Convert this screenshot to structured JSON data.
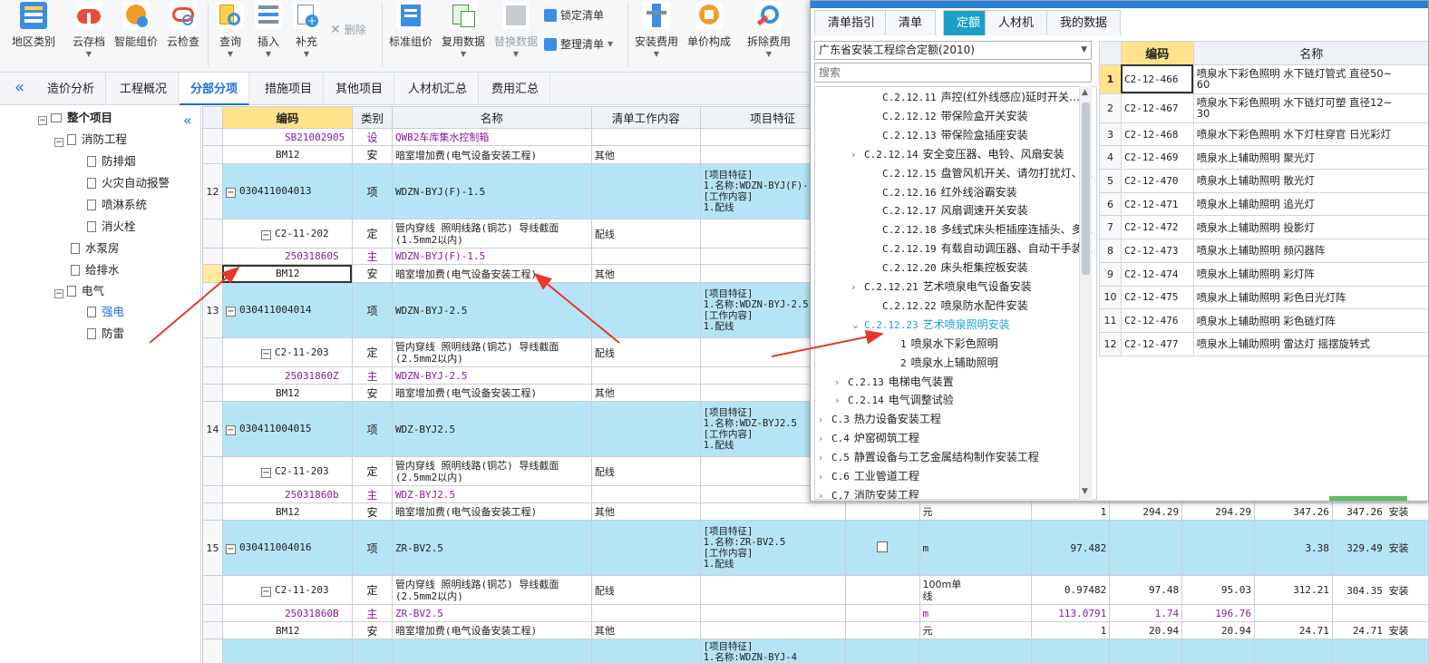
{
  "toolbar": {
    "buttons": [
      {
        "label": "地区类别",
        "icon": "region-category-icon"
      },
      {
        "label": "云存档",
        "icon": "cloud-save-icon"
      },
      {
        "label": "智能组价",
        "icon": "smart-pricing-icon"
      },
      {
        "label": "云检查",
        "icon": "cloud-check-icon"
      },
      {
        "label": "查询",
        "icon": "query-icon"
      },
      {
        "label": "插入",
        "icon": "insert-icon"
      },
      {
        "label": "补充",
        "icon": "supplement-icon"
      },
      {
        "label": "标准组价",
        "icon": "standard-pricing-icon"
      },
      {
        "label": "复用数据",
        "icon": "reuse-data-icon"
      },
      {
        "label": "替换数据",
        "icon": "replace-data-icon"
      },
      {
        "label": "安装费用",
        "icon": "install-fee-icon"
      },
      {
        "label": "单价构成",
        "icon": "unit-price-icon"
      },
      {
        "label": "拆除费用",
        "icon": "demolish-fee-icon"
      }
    ],
    "delete_label": "删除",
    "lock_list_label": "锁定清单",
    "organize_list_label": "整理清单"
  },
  "tabs": [
    "造价分析",
    "工程概况",
    "分部分项",
    "措施项目",
    "其他项目",
    "人材机汇总",
    "费用汇总"
  ],
  "active_tab": "分部分项",
  "tree": {
    "root": "整个项目",
    "nodes": [
      "消防工程",
      "防排烟",
      "火灾自动报警",
      "喷淋系统",
      "消火栓",
      "水泵房",
      "给排水",
      "电气",
      "强电",
      "防雷"
    ]
  },
  "grid": {
    "headers": [
      "编码",
      "类别",
      "名称",
      "清单工作内容",
      "项目特征"
    ],
    "rows": [
      {
        "code": "SB21002905",
        "type": "设",
        "name": "QWB2车库集水控制箱",
        "work": "",
        "feat": "",
        "purple": true
      },
      {
        "code": "BM12",
        "type": "安",
        "name": "暗室增加费(电气设备安装工程)",
        "work": "其他"
      },
      {
        "rn": "12",
        "code": "030411004013",
        "type": "项",
        "name": "WDZN-BYJ(F)-1.5",
        "feat": "[项目特征]\n1.名称:WDZN-BYJ(F)-1.5\n[工作内容]\n1.配线"
      },
      {
        "code": "C2-11-202",
        "type": "定",
        "name": "管内穿线 照明线路(铜芯) 导线截面\n(1.5mm2以内)",
        "work": "配线"
      },
      {
        "code": "25031860S",
        "type": "主",
        "name": "WDZN-BYJ(F)-1.5",
        "purple": true
      },
      {
        "code": "BM12",
        "type": "安",
        "name": "暗室增加费(电气设备安装工程)",
        "work": "其他"
      },
      {
        "rn": "13",
        "code": "030411004014",
        "type": "项",
        "name": "WDZN-BYJ-2.5",
        "feat": "[项目特征]\n1.名称:WDZN-BYJ-2.5\n[工作内容]\n1.配线"
      },
      {
        "code": "C2-11-203",
        "type": "定",
        "name": "管内穿线 照明线路(铜芯) 导线截面\n(2.5mm2以内)",
        "work": "配线"
      },
      {
        "code": "25031860Z",
        "type": "主",
        "name": "WDZN-BYJ-2.5",
        "purple": true
      },
      {
        "code": "BM12",
        "type": "安",
        "name": "暗室增加费(电气设备安装工程)",
        "work": "其他"
      },
      {
        "rn": "14",
        "code": "030411004015",
        "type": "项",
        "name": "WDZ-BYJ2.5",
        "feat": "[项目特征]\n1.名称:WDZ-BYJ2.5\n[工作内容]\n1.配线"
      },
      {
        "code": "C2-11-203",
        "type": "定",
        "name": "管内穿线 照明线路(铜芯) 导线截面\n(2.5mm2以内)",
        "work": "配线"
      },
      {
        "code": "25031860b",
        "type": "主",
        "name": "WDZ-BYJ2.5",
        "purple": true
      },
      {
        "code": "BM12",
        "type": "安",
        "name": "暗室增加费(电气设备安装工程)",
        "work": "其他",
        "unit": "元",
        "qty": "1",
        "v1": "294.29",
        "v2": "294.29",
        "v3": "347.26",
        "v4": "347.26",
        "last": "安装"
      },
      {
        "rn": "15",
        "code": "030411004016",
        "type": "项",
        "name": "ZR-BV2.5",
        "feat": "[项目特征]\n1.名称:ZR-BV2.5\n[工作内容]\n1.配线",
        "unit": "m",
        "qty": "97.482",
        "v3": "3.38",
        "v4": "329.49",
        "last": "安装"
      },
      {
        "code": "C2-11-203",
        "type": "定",
        "name": "管内穿线 照明线路(铜芯) 导线截面\n(2.5mm2以内)",
        "work": "配线",
        "unit": "100m单\n线",
        "qty": "0.97482",
        "v1": "97.48",
        "v2": "95.03",
        "v3": "312.21",
        "v4": "304.35",
        "last": "安装"
      },
      {
        "code": "25031860B",
        "type": "主",
        "name": "ZR-BV2.5",
        "unit": "m",
        "qty": "113.0791",
        "v1": "1.74",
        "v2": "196.76",
        "purple": true
      },
      {
        "code": "BM12",
        "type": "安",
        "name": "暗室增加费(电气设备安装工程)",
        "work": "其他",
        "unit": "元",
        "qty": "1",
        "v1": "20.94",
        "v2": "20.94",
        "v3": "24.71",
        "v4": "24.71",
        "last": "安装"
      },
      {
        "feat": "[项目特征]\n1.名称:WDZN-BYJ-4"
      }
    ]
  },
  "panel": {
    "tabs": [
      "清单指引",
      "清单",
      "定额",
      "人材机",
      "我的数据"
    ],
    "active_tab": "定额",
    "quota_select": "广东省安装工程综合定额(2010)",
    "search_placeholder": "搜索",
    "tree": [
      {
        "code": "C.2.12.11",
        "name": "声控(红外线感应)延时开关…"
      },
      {
        "code": "C.2.12.12",
        "name": "带保险盒开关安装"
      },
      {
        "code": "C.2.12.13",
        "name": "带保险盒插座安装"
      },
      {
        "code": "C.2.12.14",
        "name": "安全变压器、电铃、风扇安装",
        "chev": "›"
      },
      {
        "code": "C.2.12.15",
        "name": "盘管风机开关、请勿打扰灯、…"
      },
      {
        "code": "C.2.12.16",
        "name": "红外线浴霸安装"
      },
      {
        "code": "C.2.12.17",
        "name": "风扇调速开关安装"
      },
      {
        "code": "C.2.12.18",
        "name": "多线式床头柜插座连插头、多…"
      },
      {
        "code": "C.2.12.19",
        "name": "有载自动调压器、自动干手装…"
      },
      {
        "code": "C.2.12.20",
        "name": "床头柜集控板安装"
      },
      {
        "code": "C.2.12.21",
        "name": "艺术喷泉电气设备安装",
        "chev": "›"
      },
      {
        "code": "C.2.12.22",
        "name": "喷泉防水配件安装"
      },
      {
        "code": "C.2.12.23",
        "name": "艺术喷泉照明安装",
        "chev": "⌄",
        "sel": true
      },
      {
        "code": "1",
        "name": "喷泉水下彩色照明"
      },
      {
        "code": "2",
        "name": "喷泉水上辅助照明"
      },
      {
        "code": "C.2.13",
        "name": "电梯电气装置",
        "chev": "›"
      },
      {
        "code": "C.2.14",
        "name": "电气调整试验",
        "chev": "›"
      },
      {
        "code": "C.3",
        "name": "热力设备安装工程",
        "chev": "›"
      },
      {
        "code": "C.4",
        "name": "炉窑砌筑工程",
        "chev": "›"
      },
      {
        "code": "C.5",
        "name": "静置设备与工艺金属结构制作安装工程",
        "chev": "›"
      },
      {
        "code": "C.6",
        "name": "工业管道工程",
        "chev": "›"
      },
      {
        "code": "C.7",
        "name": "消防安装工程",
        "chev": "›"
      }
    ],
    "table_headers": [
      "编码",
      "名称"
    ],
    "table_rows": [
      {
        "i": "1",
        "code": "C2-12-466",
        "name": "喷泉水下彩色照明 水下链灯管式 直径50~\n60"
      },
      {
        "i": "2",
        "code": "C2-12-467",
        "name": "喷泉水下彩色照明 水下链灯可塑 直径12~\n30"
      },
      {
        "i": "3",
        "code": "C2-12-468",
        "name": "喷泉水下彩色照明 水下灯柱穿官 日光彩灯"
      },
      {
        "i": "4",
        "code": "C2-12-469",
        "name": "喷泉水上辅助照明 聚光灯"
      },
      {
        "i": "5",
        "code": "C2-12-470",
        "name": "喷泉水上辅助照明 散光灯"
      },
      {
        "i": "6",
        "code": "C2-12-471",
        "name": "喷泉水上辅助照明 追光灯"
      },
      {
        "i": "7",
        "code": "C2-12-472",
        "name": "喷泉水上辅助照明 投影灯"
      },
      {
        "i": "8",
        "code": "C2-12-473",
        "name": "喷泉水上辅助照明 频闪器阵"
      },
      {
        "i": "9",
        "code": "C2-12-474",
        "name": "喷泉水上辅助照明 彩灯阵"
      },
      {
        "i": "10",
        "code": "C2-12-475",
        "name": "喷泉水上辅助照明 彩色日光灯阵"
      },
      {
        "i": "11",
        "code": "C2-12-476",
        "name": "喷泉水上辅助照明 彩色链灯阵"
      },
      {
        "i": "12",
        "code": "C2-12-477",
        "name": "喷泉水上辅助照明 雷达灯 摇摆旋转式"
      }
    ]
  },
  "colors": {
    "accent": "#1e6fd9",
    "row_blue": "#b5e4f6",
    "header_yellow": "#ffe38a",
    "arrow": "#e8382c",
    "panel_tab_active": "#1aa0c8"
  }
}
